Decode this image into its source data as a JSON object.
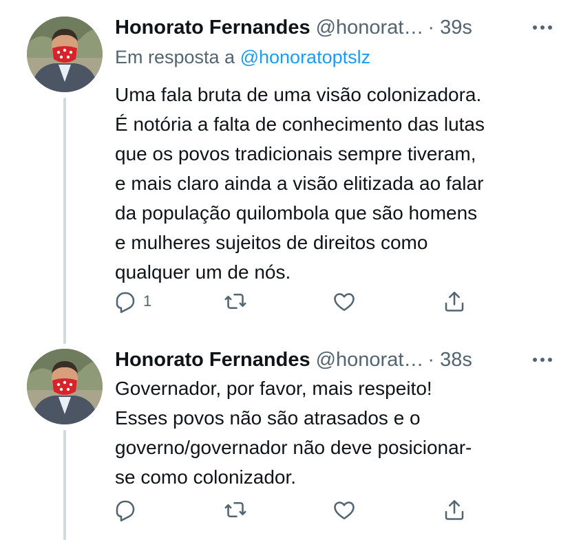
{
  "tweets": [
    {
      "author": "Honorato Fernandes",
      "handle": "@honorat…",
      "time": "· 39s",
      "reply_prefix": "Em resposta a",
      "reply_handle": "@honoratoptslz",
      "lines": [
        "Uma fala bruta de uma visão colonizadora.",
        "É notória a falta de conhecimento das lutas",
        "que os povos tradicionais sempre tiveram,",
        "e mais claro ainda a visão elitizada ao falar",
        "da população quilombola que são homens",
        "e mulheres sujeitos de direitos como",
        "qualquer um de nós."
      ],
      "reply_count": "1"
    },
    {
      "author": "Honorato Fernandes",
      "handle": "@honorat…",
      "time": "· 38s",
      "lines": [
        "Governador, por favor, mais respeito!",
        "Esses povos não são atrasados e o",
        "governo/governador não deve posicionar-",
        "se como colonizador."
      ],
      "reply_count": ""
    }
  ],
  "icons": {
    "reply": "reply-icon",
    "retweet": "retweet-icon",
    "like": "heart-icon",
    "share": "share-icon",
    "more": "more-icon"
  },
  "colors": {
    "mention": "#1d9bf0",
    "secondary": "#536471",
    "thread_line": "#cfd9de",
    "mask": "#d8232a"
  }
}
